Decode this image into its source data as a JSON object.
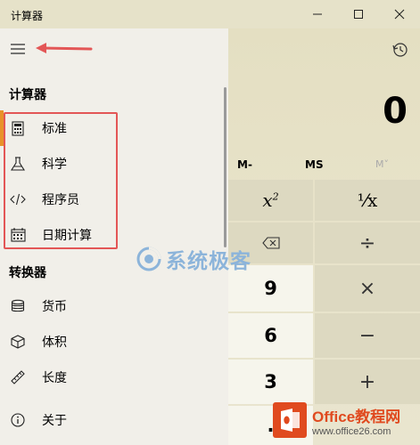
{
  "app_title": "计算器",
  "display_value": "0",
  "memory": {
    "mminus": "M-",
    "ms": "MS",
    "mdrop": "M˅"
  },
  "keys": {
    "square": "x",
    "square_sup": "2",
    "reciprocal": "⅟x",
    "backspace_icon": "backspace-icon",
    "divide": "÷",
    "nine": "9",
    "multiply": "×",
    "six": "6",
    "minus": "−",
    "three": "3",
    "plus": "+",
    "dot": "."
  },
  "nav": {
    "section_calculator": "计算器",
    "section_converter": "转换器",
    "calculator_items": [
      {
        "label": "标准",
        "icon": "standard-calculator-icon"
      },
      {
        "label": "科学",
        "icon": "flask-icon"
      },
      {
        "label": "程序员",
        "icon": "code-icon"
      },
      {
        "label": "日期计算",
        "icon": "calendar-icon"
      }
    ],
    "converter_items": [
      {
        "label": "货币",
        "icon": "currency-icon"
      },
      {
        "label": "体积",
        "icon": "cube-icon"
      },
      {
        "label": "长度",
        "icon": "ruler-icon"
      }
    ],
    "about": {
      "label": "关于",
      "icon": "info-icon"
    }
  },
  "watermarks": {
    "center_text": "系统极客",
    "office_brand": "Office教程网",
    "office_url": "www.office26.com"
  },
  "colors": {
    "selection_accent": "#e89229",
    "annotation_red": "#e35656",
    "office_orange": "#e04a1f"
  }
}
